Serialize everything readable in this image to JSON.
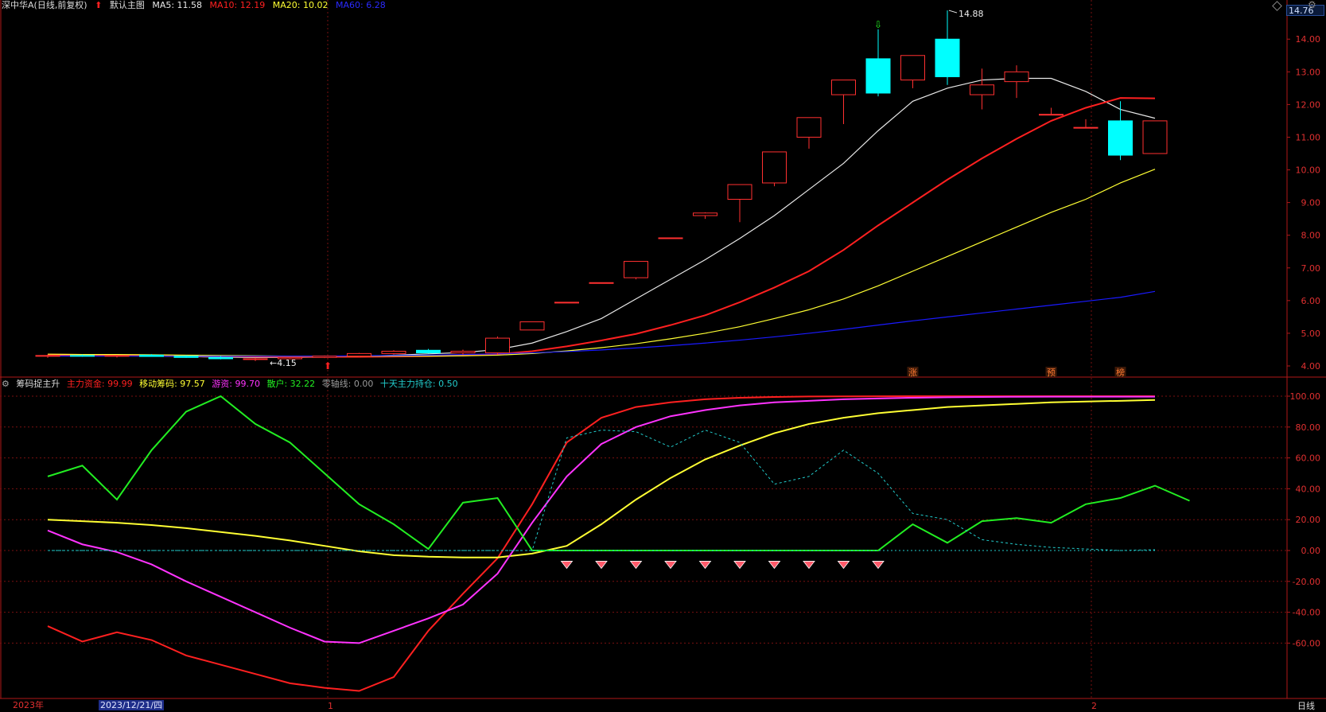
{
  "header": {
    "stock_name": "深中华A(日线,前复权)",
    "arrow_icon": "red-up-arrow-icon",
    "template_name": "默认主图",
    "ma5": "MA5: 11.58",
    "ma10": "MA10: 12.19",
    "ma20": "MA20: 10.02",
    "ma60": "MA60: 6.28"
  },
  "indicator_header": {
    "name": "筹码捉主升",
    "main_fund": "主力资金: 99.99",
    "moving_chips": "移动筹码: 97.57",
    "hot_money": "游资: 99.70",
    "retail": "散户: 32.22",
    "zero_axis": "零轴线: 0.00",
    "ten_day_hold": "十天主力持仓: 0.50"
  },
  "price_box": "14.76",
  "price_axis": [
    "14.00",
    "13.00",
    "12.00",
    "11.00",
    "10.00",
    "9.00",
    "8.00",
    "7.00",
    "6.00",
    "5.00",
    "4.00"
  ],
  "ind_axis": [
    "100.00",
    "80.00",
    "60.00",
    "40.00",
    "20.00",
    "0.00",
    "-20.00",
    "-40.00",
    "-60.00"
  ],
  "annotations": {
    "high": "14.88",
    "low": "4.15"
  },
  "markers": [
    "涨",
    "预",
    "榜"
  ],
  "time_axis": {
    "year": "2023年",
    "cursor_date": "2023/12/21/四",
    "jan": "1",
    "feb": "2",
    "period": "日线"
  },
  "colors": {
    "ma5": "#e8e8e8",
    "ma10": "#ff2020",
    "ma20": "#ffff33",
    "ma60": "#1a1aff",
    "up": "#ff3030",
    "down": "#00ffff",
    "main_fund": "#ff2020",
    "moving": "#ffff33",
    "hot": "#ff33ff",
    "retail": "#22ee22",
    "ten_day": "#22cccc"
  },
  "chart_data": [
    {
      "type": "candlestick",
      "title": "深中华A(日线,前复权)",
      "ylim": [
        3.8,
        14.9
      ],
      "candles": [
        {
          "o": 4.3,
          "h": 4.35,
          "l": 4.25,
          "c": 4.32
        },
        {
          "o": 4.32,
          "h": 4.35,
          "l": 4.28,
          "c": 4.3
        },
        {
          "o": 4.3,
          "h": 4.34,
          "l": 4.26,
          "c": 4.32
        },
        {
          "o": 4.33,
          "h": 4.36,
          "l": 4.28,
          "c": 4.29
        },
        {
          "o": 4.3,
          "h": 4.33,
          "l": 4.25,
          "c": 4.26
        },
        {
          "o": 4.26,
          "h": 4.3,
          "l": 4.2,
          "c": 4.22
        },
        {
          "o": 4.2,
          "h": 4.25,
          "l": 4.15,
          "c": 4.22
        },
        {
          "o": 4.22,
          "h": 4.28,
          "l": 4.2,
          "c": 4.26
        },
        {
          "o": 4.26,
          "h": 4.32,
          "l": 4.24,
          "c": 4.3
        },
        {
          "o": 4.3,
          "h": 4.4,
          "l": 4.28,
          "c": 4.38
        },
        {
          "o": 4.38,
          "h": 4.48,
          "l": 4.35,
          "c": 4.45
        },
        {
          "o": 4.48,
          "h": 4.52,
          "l": 4.38,
          "c": 4.4
        },
        {
          "o": 4.4,
          "h": 4.5,
          "l": 4.35,
          "c": 4.45
        },
        {
          "o": 4.4,
          "h": 4.9,
          "l": 4.35,
          "c": 4.85
        },
        {
          "o": 5.1,
          "h": 5.35,
          "l": 5.1,
          "c": 5.35
        },
        {
          "o": 5.95,
          "h": 5.95,
          "l": 5.95,
          "c": 5.95
        },
        {
          "o": 6.55,
          "h": 6.55,
          "l": 6.55,
          "c": 6.55
        },
        {
          "o": 6.7,
          "h": 7.2,
          "l": 6.65,
          "c": 7.2
        },
        {
          "o": 7.92,
          "h": 7.92,
          "l": 7.92,
          "c": 7.92
        },
        {
          "o": 8.6,
          "h": 8.7,
          "l": 8.5,
          "c": 8.68
        },
        {
          "o": 9.1,
          "h": 9.55,
          "l": 8.4,
          "c": 9.55
        },
        {
          "o": 9.6,
          "h": 10.55,
          "l": 9.5,
          "c": 10.55
        },
        {
          "o": 11.0,
          "h": 11.6,
          "l": 10.65,
          "c": 11.6
        },
        {
          "o": 12.3,
          "h": 12.75,
          "l": 11.4,
          "c": 12.75
        },
        {
          "o": 13.4,
          "h": 14.3,
          "l": 12.25,
          "c": 12.35
        },
        {
          "o": 12.75,
          "h": 13.5,
          "l": 12.5,
          "c": 13.5
        },
        {
          "o": 14.0,
          "h": 14.88,
          "l": 12.6,
          "c": 12.85
        },
        {
          "o": 12.3,
          "h": 13.1,
          "l": 11.85,
          "c": 12.6
        },
        {
          "o": 12.7,
          "h": 13.2,
          "l": 12.2,
          "c": 13.0
        },
        {
          "o": 11.7,
          "h": 11.9,
          "l": 11.7,
          "c": 11.7
        },
        {
          "o": 11.3,
          "h": 11.55,
          "l": 11.3,
          "c": 11.3
        },
        {
          "o": 11.5,
          "h": 12.1,
          "l": 10.3,
          "c": 10.45
        },
        {
          "o": 10.5,
          "h": 11.5,
          "l": 10.5,
          "c": 11.5
        }
      ],
      "series": [
        {
          "name": "MA5",
          "values": [
            4.33,
            4.32,
            4.31,
            4.3,
            4.29,
            4.27,
            4.26,
            4.26,
            4.27,
            4.29,
            4.33,
            4.37,
            4.41,
            4.5,
            4.7,
            5.05,
            5.45,
            6.05,
            6.65,
            7.25,
            7.9,
            8.6,
            9.4,
            10.2,
            11.2,
            12.1,
            12.5,
            12.75,
            12.8,
            12.8,
            12.4,
            11.85,
            11.58
          ]
        },
        {
          "name": "MA10",
          "values": [
            4.35,
            4.34,
            4.33,
            4.32,
            4.31,
            4.3,
            4.29,
            4.28,
            4.28,
            4.28,
            4.29,
            4.3,
            4.32,
            4.36,
            4.45,
            4.6,
            4.78,
            4.98,
            5.25,
            5.55,
            5.95,
            6.4,
            6.9,
            7.55,
            8.3,
            9.0,
            9.7,
            10.35,
            10.95,
            11.5,
            11.9,
            12.2,
            12.19
          ]
        },
        {
          "name": "MA20",
          "values": [
            4.36,
            4.35,
            4.35,
            4.34,
            4.33,
            4.32,
            4.31,
            4.3,
            4.3,
            4.3,
            4.3,
            4.3,
            4.31,
            4.33,
            4.38,
            4.46,
            4.56,
            4.68,
            4.83,
            5.0,
            5.2,
            5.45,
            5.72,
            6.05,
            6.45,
            6.9,
            7.35,
            7.8,
            8.25,
            8.7,
            9.1,
            9.6,
            10.02
          ]
        },
        {
          "name": "MA60",
          "values": [
            4.3,
            4.3,
            4.3,
            4.3,
            4.3,
            4.3,
            4.3,
            4.3,
            4.3,
            4.31,
            4.32,
            4.33,
            4.35,
            4.37,
            4.4,
            4.44,
            4.49,
            4.55,
            4.62,
            4.7,
            4.79,
            4.89,
            5.0,
            5.12,
            5.25,
            5.38,
            5.5,
            5.62,
            5.74,
            5.86,
            5.98,
            6.1,
            6.28
          ]
        }
      ]
    },
    {
      "type": "line",
      "title": "筹码捉主升",
      "ylim": [
        -95,
        106
      ],
      "series": [
        {
          "name": "主力资金",
          "values": [
            -49,
            -59,
            -53,
            -58,
            -68,
            -74,
            -80,
            -86,
            -89,
            -91,
            -82,
            -52,
            -28,
            -5,
            30,
            70,
            86,
            93,
            96,
            98,
            99,
            99.5,
            99.8,
            99.9,
            99.95,
            99.97,
            99.98,
            99.99,
            99.99,
            99.99,
            99.99,
            99.99,
            99.99
          ]
        },
        {
          "name": "移动筹码",
          "values": [
            20,
            19,
            18,
            16.5,
            14.5,
            12,
            9.5,
            6.5,
            3,
            -0.5,
            -3,
            -4,
            -4.5,
            -4.5,
            -2,
            3,
            17,
            33,
            47,
            59,
            68,
            76,
            82,
            86,
            89,
            91,
            93,
            94,
            95,
            96,
            96.5,
            97,
            97.57
          ]
        },
        {
          "name": "游资",
          "values": [
            13,
            4,
            -1,
            -9,
            -20,
            -30,
            -40,
            -50,
            -59,
            -60,
            -52,
            -44,
            -35,
            -15,
            18,
            48,
            69,
            80,
            87,
            91,
            94,
            96,
            97,
            98,
            98.5,
            99,
            99.3,
            99.5,
            99.6,
            99.65,
            99.68,
            99.7,
            99.7
          ]
        },
        {
          "name": "散户",
          "values": [
            48,
            55,
            33,
            65,
            90,
            100,
            82,
            70,
            50,
            30,
            17,
            1,
            31,
            34,
            0,
            0,
            0,
            0,
            0,
            0,
            0,
            0,
            0,
            0,
            0,
            17,
            5,
            19,
            21,
            18,
            30,
            34,
            42,
            32.22
          ]
        },
        {
          "name": "十天主力持仓",
          "values": [
            0,
            0,
            0,
            0,
            0,
            0,
            0,
            0,
            0,
            0,
            0,
            0,
            0,
            0,
            0,
            73,
            78,
            77,
            67,
            78,
            70,
            43,
            48,
            65,
            50,
            24,
            20,
            7,
            4,
            2,
            1,
            0,
            0.5
          ]
        }
      ]
    }
  ]
}
